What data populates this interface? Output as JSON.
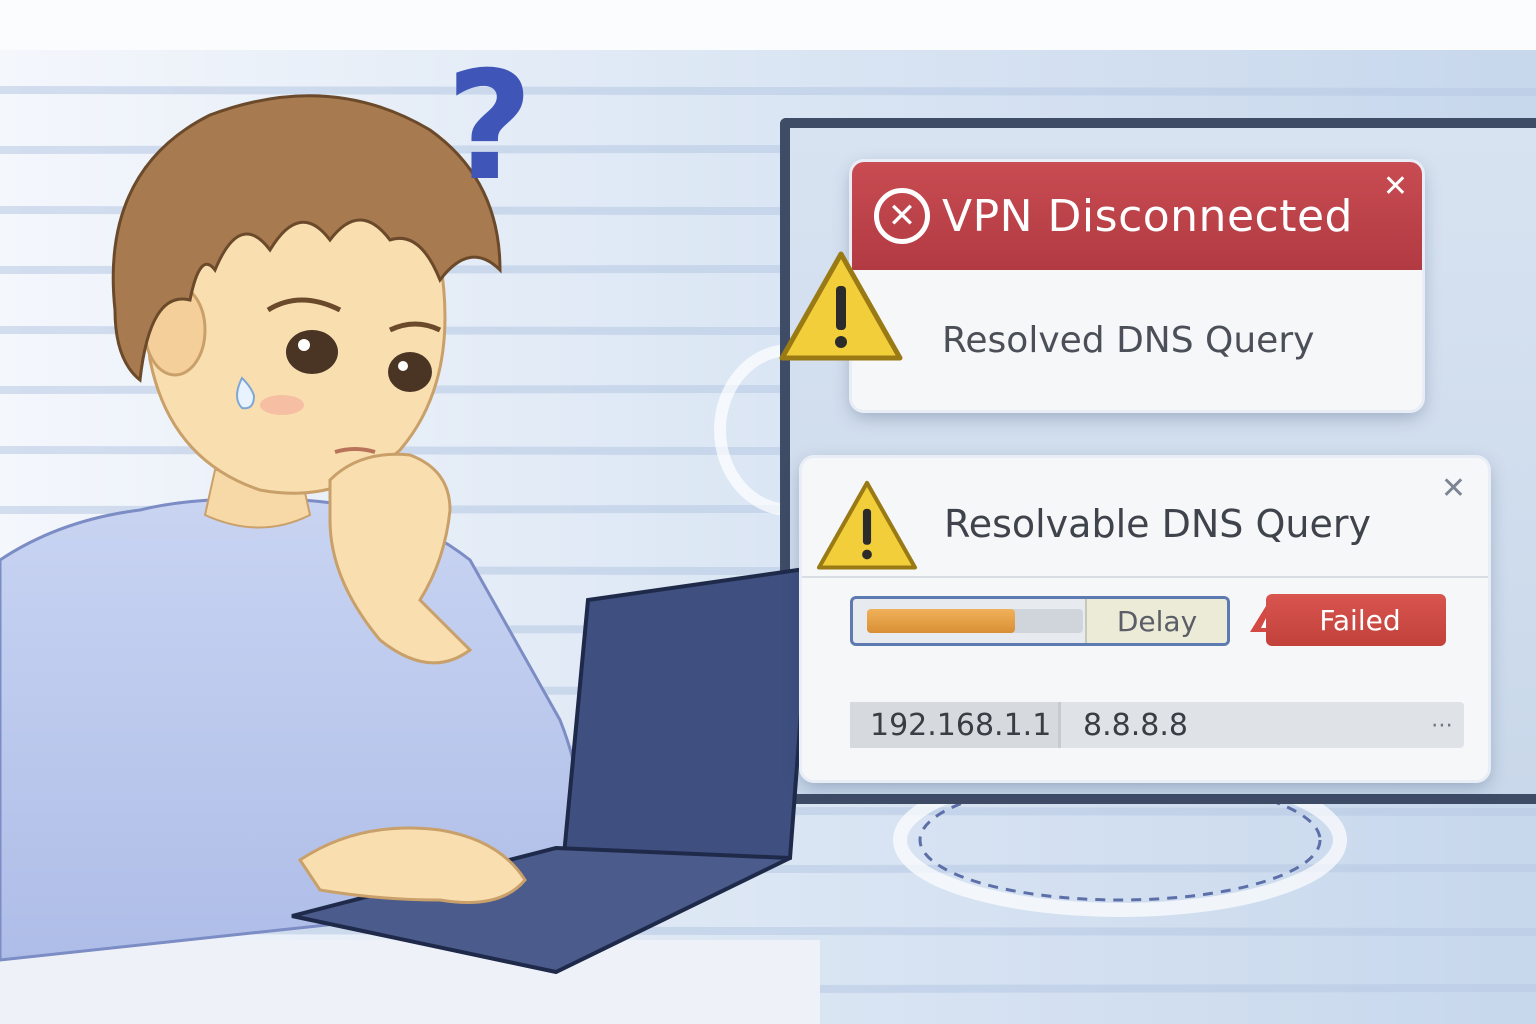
{
  "illustration": {
    "question_mark": "?"
  },
  "dialogs": {
    "vpn": {
      "title": "VPN Disconnected",
      "close_glyph": "✕",
      "error_glyph": "✕",
      "message": "Resolved DNS Query"
    },
    "dns": {
      "title": "Resolvable DNS Query",
      "close_glyph": "✕",
      "progress": {
        "label": "Delay",
        "fraction": 0.42
      },
      "status_button": "Failed",
      "servers": [
        "192.168.1.1",
        "8.8.8.8"
      ],
      "more_glyph": "⋯"
    }
  },
  "colors": {
    "error_red": "#b23a42",
    "warning_yellow": "#f2cf3a",
    "progress_orange": "#d98f34"
  }
}
